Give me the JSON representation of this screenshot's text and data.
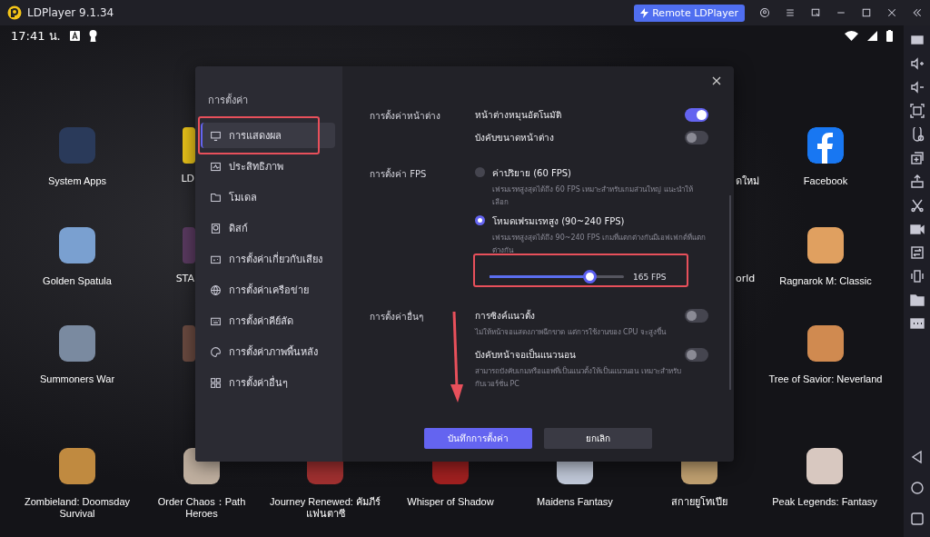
{
  "window": {
    "title": "LDPlayer 9.1.34",
    "remote_button": "Remote LDPlayer"
  },
  "status_bar": {
    "time": "17:41 น."
  },
  "apps": [
    {
      "label": "System Apps"
    },
    {
      "label": "LD"
    },
    {
      "label": "ดใหม่"
    },
    {
      "label": "Facebook"
    },
    {
      "label": "Golden Spatula"
    },
    {
      "label": "STA"
    },
    {
      "label": "orld"
    },
    {
      "label": "Ragnarok M: Classic"
    },
    {
      "label": "Summoners War"
    },
    {
      "label": "Tree of Savior: Neverland"
    },
    {
      "label": "Zombieland: Doomsday Survival"
    },
    {
      "label": "Order Chaos：Path Heroes"
    },
    {
      "label": "Journey Renewed: คัมภีร์แฟนตาซี"
    },
    {
      "label": "Whisper of Shadow"
    },
    {
      "label": "Maidens Fantasy"
    },
    {
      "label": "สกายยูโทเปีย"
    },
    {
      "label": "Peak Legends: Fantasy"
    }
  ],
  "dialog": {
    "title": "การตั้งค่า",
    "nav": [
      {
        "label": "การแสดงผล",
        "selected": true
      },
      {
        "label": "ประสิทธิภาพ",
        "selected": false
      },
      {
        "label": "โมเดล",
        "selected": false
      },
      {
        "label": "ดิสก์",
        "selected": false
      },
      {
        "label": "การตั้งค่าเกี่ยวกับเสียง",
        "selected": false
      },
      {
        "label": "การตั้งค่าเครือข่าย",
        "selected": false
      },
      {
        "label": "การตั้งค่าคีย์ลัด",
        "selected": false
      },
      {
        "label": "การตั้งค่าภาพพื้นหลัง",
        "selected": false
      },
      {
        "label": "การตั้งค่าอื่นๆ",
        "selected": false
      }
    ],
    "sections": [
      {
        "label": "การตั้งค่าหน้าต่าง",
        "options": [
          {
            "kind": "toggle",
            "label": "หน้าต่างหมุนอัตโนมัติ",
            "on": true
          },
          {
            "kind": "toggle",
            "label": "บังคับขนาดหน้าต่าง",
            "on": false
          }
        ]
      },
      {
        "label": "การตั้งค่า FPS",
        "options": [
          {
            "kind": "radio",
            "label": "ค่าปริยาย (60 FPS)",
            "description": "เฟรมเรทสูงสุดได้ถึง 60 FPS เหมาะสำหรับเกมส่วนใหญ่ แนะนำให้เลือก",
            "selected": false
          },
          {
            "kind": "radio",
            "label": "โหมดเฟรมเรทสูง (90~240 FPS)",
            "description": "เฟรมเรทสูงสุดได้ถึง 90~240 FPS เกมที่แตกต่างกันมีเอฟเฟกต์ที่แตกต่างกัน",
            "selected": true
          },
          {
            "kind": "slider",
            "level": 0.74,
            "reading": "165 FPS"
          }
        ]
      },
      {
        "label": "การตั้งค่าอื่นๆ",
        "options": [
          {
            "kind": "toggle",
            "label": "การซิงค์แนวตั้ง",
            "description": "ไม่ให้หน้าจอแสดงภาพฉีกขาด แต่การใช้งานของ CPU จะสูงขึ้น",
            "on": false
          },
          {
            "kind": "toggle",
            "label": "บังคับหน้าจอเป็นแนวนอน",
            "description": "สามารถบังคับเกมหรือแอพที่เป็นแนวตั้งให้เป็นแนวนอน เหมาะสำหรับกับเวอร์ชั่น PC",
            "on": false
          }
        ]
      }
    ],
    "save_button": "บันทึกการตั้งค่า",
    "cancel_button": "ยกเลิก"
  }
}
